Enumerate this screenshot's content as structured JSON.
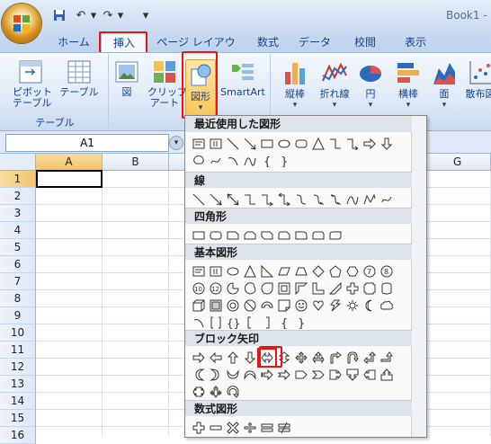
{
  "window": {
    "title": "Book1 -"
  },
  "quick_access": [
    "save-icon",
    "undo-icon",
    "redo-icon",
    "customize-icon"
  ],
  "tabs": [
    "ホーム",
    "挿入",
    "ページ レイアウト",
    "数式",
    "データ",
    "校閲",
    "表示"
  ],
  "ribbon": {
    "groups": [
      {
        "label": "テーブル",
        "buttons": [
          "ピボット\nテーブル",
          "テーブル"
        ]
      },
      {
        "label": "",
        "buttons": [
          "図",
          "クリップ\nアート",
          "図形",
          "SmartArt"
        ]
      },
      {
        "label": "",
        "buttons": [
          "縦棒",
          "折れ線",
          "円",
          "横棒",
          "面",
          "散布図"
        ]
      }
    ]
  },
  "namebox": {
    "value": "A1"
  },
  "columns": [
    "A",
    "B",
    "G"
  ],
  "rows": [
    "1",
    "2",
    "3",
    "4",
    "5",
    "6",
    "7",
    "8",
    "9",
    "10",
    "11",
    "12",
    "13",
    "14",
    "15",
    "16"
  ],
  "shapes_menu": {
    "sections": [
      "最近使用した図形",
      "線",
      "四角形",
      "基本図形",
      "ブロック矢印",
      "数式図形"
    ]
  },
  "colors": {
    "highlight": "#e11111",
    "accent": "#15428b"
  }
}
